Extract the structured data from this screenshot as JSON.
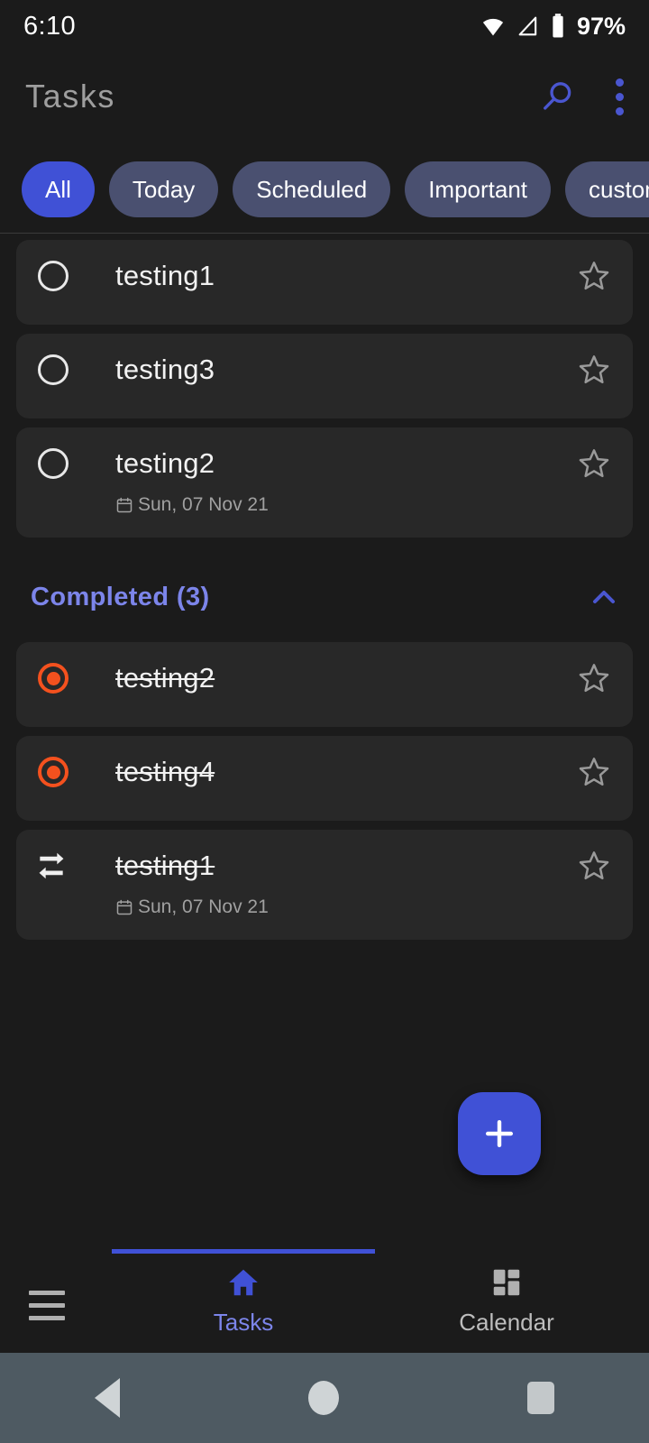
{
  "status_bar": {
    "time": "6:10",
    "battery_text": "97%",
    "icons": [
      "wifi-icon",
      "signal-icon",
      "battery-icon"
    ]
  },
  "app_bar": {
    "title": "Tasks",
    "search_icon": "search-icon",
    "overflow_icon": "more-vertical-icon",
    "accent_color": "#4a56d0"
  },
  "filters": {
    "chips": [
      {
        "label": "All",
        "active": true
      },
      {
        "label": "Today",
        "active": false
      },
      {
        "label": "Scheduled",
        "active": false
      },
      {
        "label": "Important",
        "active": false
      },
      {
        "label": "custome l",
        "active": false
      }
    ],
    "active_color": "#4051d6",
    "inactive_color": "#4a5070"
  },
  "tasks": {
    "pending": [
      {
        "title": "testing1",
        "icon": "circle-unchecked-icon",
        "starred": false,
        "date": ""
      },
      {
        "title": "testing3",
        "icon": "circle-unchecked-icon",
        "starred": false,
        "date": ""
      },
      {
        "title": "testing2",
        "icon": "circle-unchecked-icon",
        "starred": false,
        "date": "Sun, 07 Nov 21"
      }
    ],
    "completed_header": "Completed (3)",
    "collapse_icon": "chevron-up-icon",
    "completed": [
      {
        "title": "testing2",
        "icon": "radio-checked-icon",
        "starred": false,
        "date": ""
      },
      {
        "title": "testing4",
        "icon": "radio-checked-icon",
        "starred": false,
        "date": ""
      },
      {
        "title": "testing1",
        "icon": "repeat-icon",
        "starred": false,
        "date": "Sun, 07 Nov 21"
      }
    ],
    "done_color": "#f4511e",
    "header_color": "#7c85ea"
  },
  "fab": {
    "icon": "plus-icon",
    "color": "#4051d6"
  },
  "bottom_nav": {
    "menu_icon": "hamburger-menu-icon",
    "items": [
      {
        "label": "Tasks",
        "icon": "home-icon",
        "active": true
      },
      {
        "label": "Calendar",
        "icon": "dashboard-grid-icon",
        "active": false
      }
    ],
    "active_color": "#7c85ea",
    "indicator_color": "#4051d6"
  },
  "system_nav": {
    "back": "back-triangle-icon",
    "home": "home-circle-icon",
    "recents": "recents-square-icon"
  }
}
